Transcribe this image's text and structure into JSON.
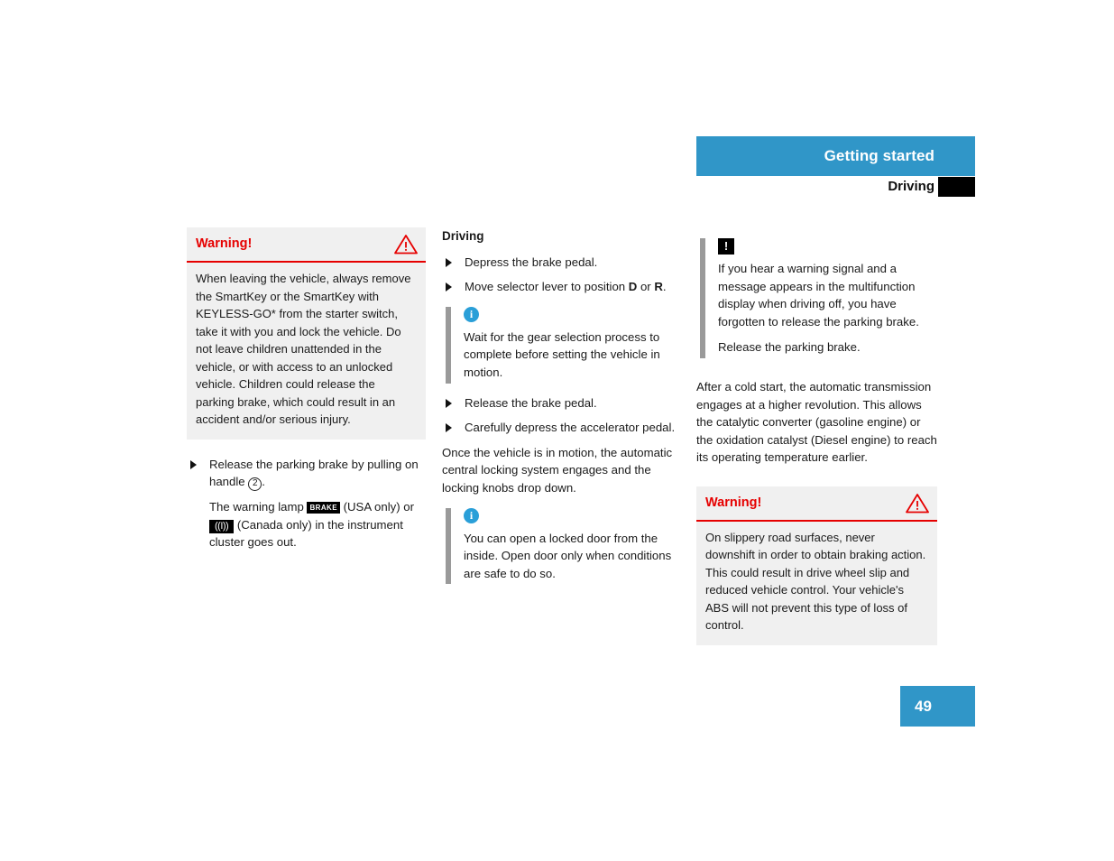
{
  "header": {
    "section_title": "Getting started",
    "sub_title": "Driving",
    "blue_color": "#3096c8",
    "tab_color": "#000000"
  },
  "left_column": {
    "warning": {
      "title": "Warning!",
      "icon": "warning-triangle-icon",
      "body": "When leaving the vehicle, always remove the SmartKey or the SmartKey with KEYLESS-GO* from the starter switch, take it with you and lock the vehicle. Do not leave children unattended in the vehicle, or with access to an unlocked vehicle. Children could release the parking brake, which could result in an accident and/or serious injury."
    },
    "step": {
      "text_before": "Release the parking brake by pulling on handle ",
      "circled_number": "2",
      "text_after": "."
    },
    "lamp_note": {
      "part1": "The warning lamp ",
      "brake_symbol": "BRAKE",
      "part2": " (USA only) or ",
      "canada_symbol": "((I))",
      "part3": " (Canada only) in the instrument cluster goes out."
    }
  },
  "mid_column": {
    "title": "Driving",
    "steps": [
      "Depress the brake pedal.",
      "Release the brake pedal.",
      "Carefully depress the accelerator pedal."
    ],
    "selector_step": {
      "text1": "Move selector lever to position ",
      "gear_d": "D",
      "text2": " or ",
      "gear_r": "R",
      "text3": "."
    },
    "note1": {
      "icon": "info-icon",
      "text": "Wait for the gear selection process to complete before setting the vehicle in motion."
    },
    "paragraph": "Once the vehicle is in motion, the automatic central locking system engages and the locking knobs drop down.",
    "note2": {
      "icon": "info-icon",
      "text": "You can open a locked door from the inside. Open door only when conditions are safe to do so."
    }
  },
  "right_column": {
    "note": {
      "icon": "exclamation-box-icon",
      "text1": "If you hear a warning signal and a message appears in the multifunction display when driving off, you have forgotten to release the parking brake.",
      "text2": "Release the parking brake."
    },
    "paragraph": "After a cold start, the automatic transmission engages at a higher revolution. This allows the catalytic converter (gasoline engine) or the oxidation catalyst (Diesel engine) to reach its operating temperature earlier.",
    "warning": {
      "title": "Warning!",
      "icon": "warning-triangle-icon",
      "body": "On slippery road surfaces, never downshift in order to obtain braking action. This could result in drive wheel slip and reduced vehicle control. Your vehicle's ABS will not prevent this type of loss of control."
    }
  },
  "footer": {
    "page_number": "49",
    "color": "#3096c8"
  }
}
